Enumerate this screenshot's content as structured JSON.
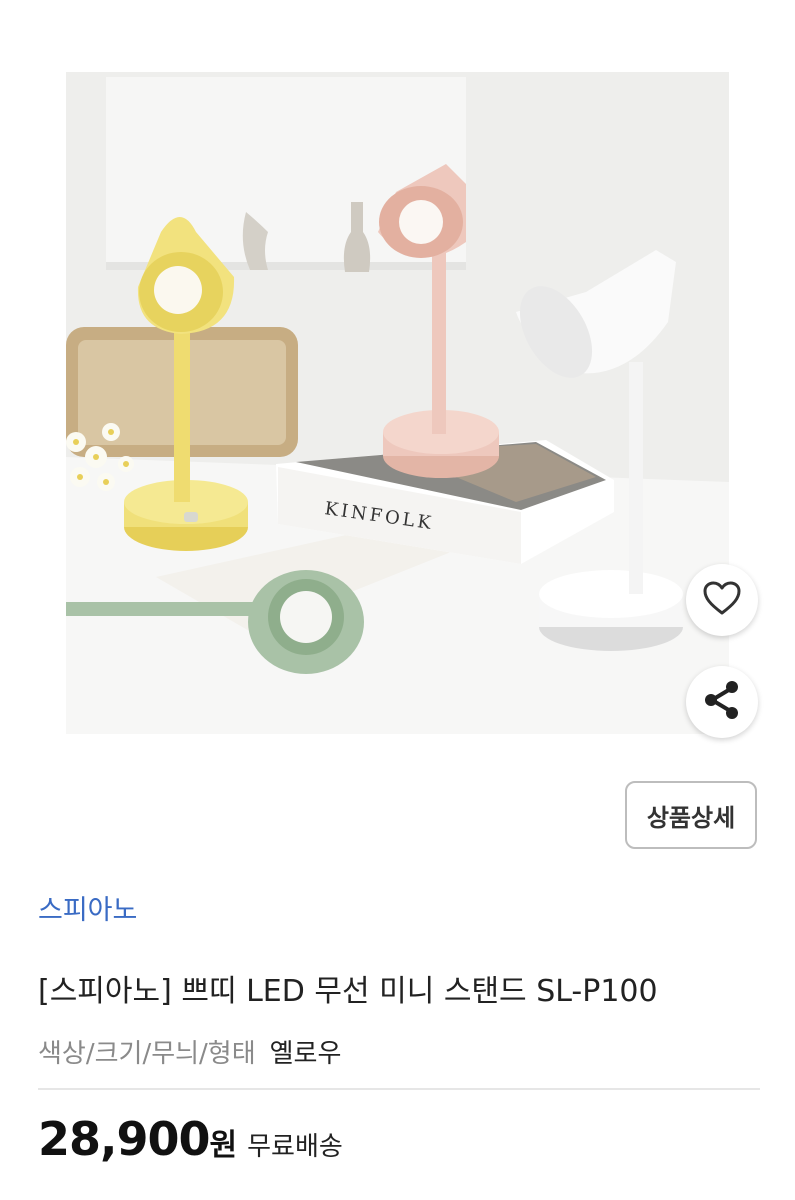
{
  "photo": {
    "book_title": "KINFOLK"
  },
  "actions": {
    "heart_icon": "heart-outline",
    "share_icon": "share"
  },
  "detail_button_label": "상품상세",
  "brand": "스피아노",
  "title": "[스피아노] 쁘띠 LED 무선 미니 스탠드 SL-P100",
  "option": {
    "label": "색상/크기/무늬/형태",
    "value": "옐로우"
  },
  "price": {
    "amount": "28,900",
    "currency": "원",
    "shipping": "무료배송"
  },
  "colors": {
    "brand": "#3a6bc4",
    "lamp_yellow": "#f0e07a",
    "lamp_pink": "#eec8bd",
    "lamp_white": "#f7f7f7",
    "lamp_green": "#a9c2a7"
  }
}
